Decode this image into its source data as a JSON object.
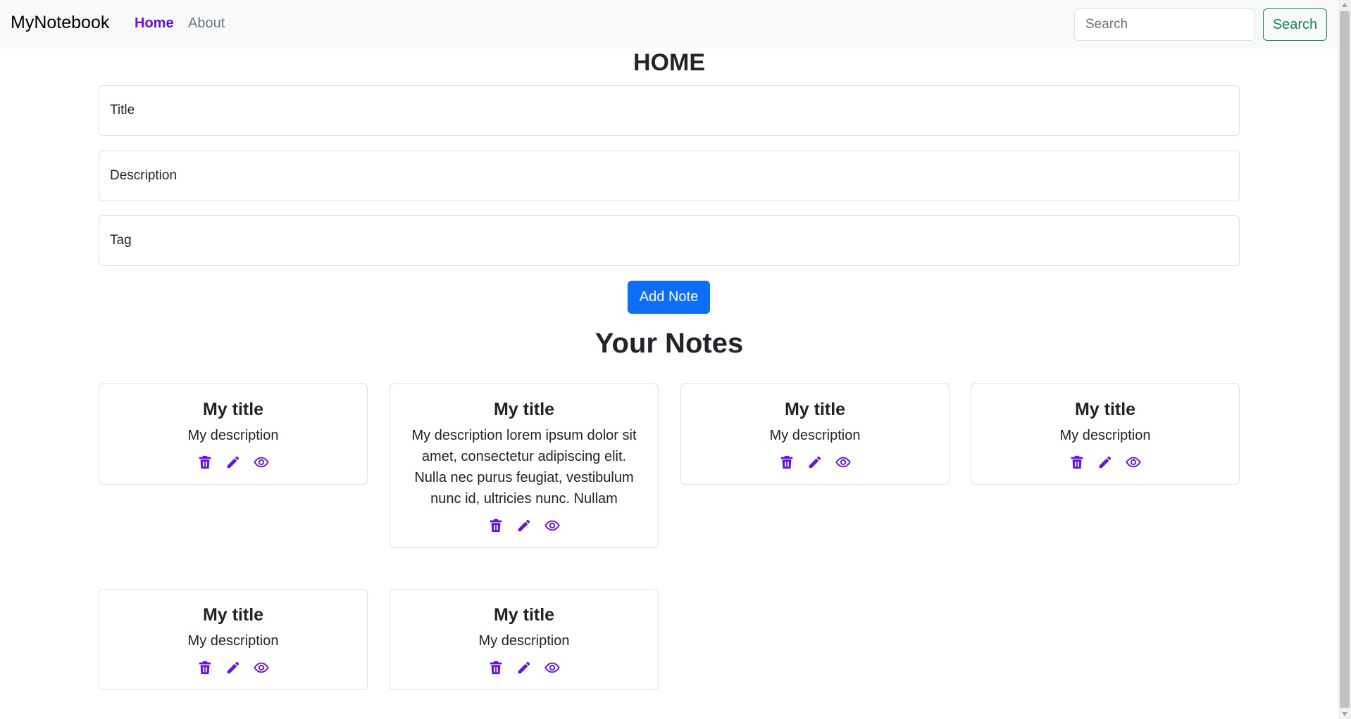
{
  "navbar": {
    "brand": "MyNotebook",
    "links": [
      "Home",
      "About"
    ],
    "search_placeholder": "Search",
    "search_button": "Search"
  },
  "page_title": "HOME",
  "form": {
    "title_placeholder": "Title",
    "description_placeholder": "Description",
    "tag_placeholder": "Tag",
    "add_button": "Add Note"
  },
  "notes_title": "Your Notes",
  "notes": [
    {
      "title": "My title",
      "description": "My description"
    },
    {
      "title": "My title",
      "description": "My description lorem ipsum dolor sit amet, consectetur adipiscing elit. Nulla nec purus feugiat, vestibulum nunc id, ultricies nunc. Nullam"
    },
    {
      "title": "My title",
      "description": "My description"
    },
    {
      "title": "My title",
      "description": "My description"
    },
    {
      "title": "My title",
      "description": "My description"
    },
    {
      "title": "My title",
      "description": "My description"
    }
  ],
  "note_actions": [
    "trash-icon",
    "pencil-icon",
    "eye-icon"
  ],
  "colors": {
    "accent": "#6610f2",
    "primary": "#0d6efd",
    "success": "#198754",
    "navbar_bg": "#f8f9fa"
  }
}
